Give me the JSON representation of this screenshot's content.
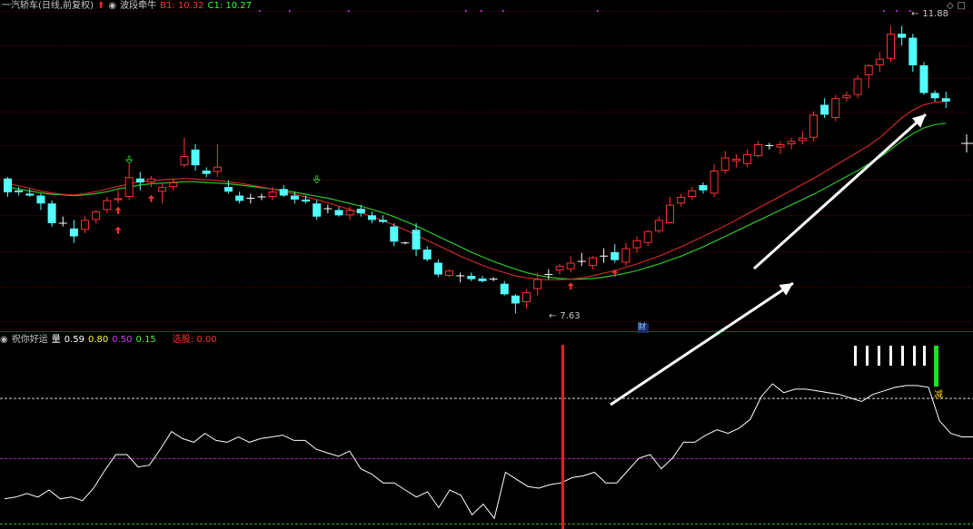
{
  "header": {
    "security": "一汽轿车(日线,前复权)",
    "indicator": "波段牵牛",
    "b1_label": "B1: 10.32",
    "c1_label": "C1: 10.27"
  },
  "sub_header": {
    "indicator": "祝你好运",
    "vol_label": "量",
    "v1": "0.59",
    "v2": "0.80",
    "v3": "0.50",
    "v4": "0.15",
    "select_label": "选股: 0.00"
  },
  "annotations": {
    "high_label": "11.88",
    "low_label": "7.63",
    "finance_badge": "财",
    "sell_badge": "减"
  },
  "colors": {
    "up": "#ff3232",
    "down": "#54ffff",
    "ma_red": "#c82828",
    "ma_green": "#28c828",
    "grid": "#6a0000",
    "signal_line": "#e61e1e",
    "oscillator": "#ffffff"
  },
  "chart_data": [
    {
      "type": "candlestick",
      "title": "一汽轿车(日线,前复权)",
      "series_name": "波段牵牛",
      "ohlc": [
        [
          9.68,
          9.7,
          9.4,
          9.47
        ],
        [
          9.5,
          9.55,
          9.42,
          9.47
        ],
        [
          9.45,
          9.52,
          9.4,
          9.42
        ],
        [
          9.42,
          9.45,
          9.2,
          9.3
        ],
        [
          9.3,
          9.35,
          8.95,
          9.0
        ],
        [
          9.0,
          9.1,
          8.95,
          8.98
        ],
        [
          8.92,
          9.05,
          8.7,
          8.8
        ],
        [
          8.9,
          9.1,
          8.85,
          9.05
        ],
        [
          9.05,
          9.2,
          9.0,
          9.18
        ],
        [
          9.2,
          9.4,
          9.15,
          9.35
        ],
        [
          9.35,
          9.5,
          9.3,
          9.38
        ],
        [
          9.4,
          9.9,
          9.35,
          9.7
        ],
        [
          9.68,
          9.78,
          9.5,
          9.62
        ],
        [
          9.62,
          9.72,
          9.55,
          9.68
        ],
        [
          9.48,
          9.6,
          9.3,
          9.55
        ],
        [
          9.55,
          9.68,
          9.5,
          9.62
        ],
        [
          9.88,
          10.3,
          9.85,
          10.02
        ],
        [
          10.12,
          10.2,
          9.8,
          9.88
        ],
        [
          9.8,
          9.85,
          9.7,
          9.75
        ],
        [
          9.78,
          10.2,
          9.7,
          9.86
        ],
        [
          9.55,
          9.65,
          9.45,
          9.48
        ],
        [
          9.42,
          9.48,
          9.3,
          9.34
        ],
        [
          9.38,
          9.45,
          9.3,
          9.36
        ],
        [
          9.38,
          9.45,
          9.35,
          9.4
        ],
        [
          9.4,
          9.55,
          9.35,
          9.48
        ],
        [
          9.52,
          9.58,
          9.4,
          9.42
        ],
        [
          9.42,
          9.48,
          9.3,
          9.36
        ],
        [
          9.36,
          9.42,
          9.3,
          9.33
        ],
        [
          9.3,
          9.35,
          9.05,
          9.1
        ],
        [
          9.2,
          9.28,
          9.15,
          9.22
        ],
        [
          9.2,
          9.25,
          9.1,
          9.12
        ],
        [
          9.12,
          9.25,
          9.05,
          9.2
        ],
        [
          9.22,
          9.28,
          9.1,
          9.15
        ],
        [
          9.12,
          9.18,
          9.0,
          9.05
        ],
        [
          9.05,
          9.12,
          9.0,
          9.02
        ],
        [
          8.95,
          9.0,
          8.65,
          8.72
        ],
        [
          8.7,
          8.72,
          8.68,
          8.7
        ],
        [
          8.9,
          9.0,
          8.5,
          8.6
        ],
        [
          8.6,
          8.65,
          8.42,
          8.45
        ],
        [
          8.4,
          8.45,
          8.18,
          8.22
        ],
        [
          8.2,
          8.3,
          8.18,
          8.28
        ],
        [
          8.18,
          8.25,
          8.1,
          8.2
        ],
        [
          8.2,
          8.25,
          8.12,
          8.15
        ],
        [
          8.16,
          8.2,
          8.1,
          8.12
        ],
        [
          8.15,
          8.18,
          8.12,
          8.15
        ],
        [
          8.08,
          8.12,
          7.9,
          7.92
        ],
        [
          7.9,
          7.92,
          7.63,
          7.78
        ],
        [
          7.8,
          8.0,
          7.7,
          7.95
        ],
        [
          8.0,
          8.25,
          7.9,
          8.15
        ],
        [
          8.2,
          8.3,
          8.15,
          8.22
        ],
        [
          8.28,
          8.38,
          8.22,
          8.35
        ],
        [
          8.3,
          8.5,
          8.25,
          8.4
        ],
        [
          8.4,
          8.55,
          8.35,
          8.42
        ],
        [
          8.35,
          8.5,
          8.3,
          8.48
        ],
        [
          8.48,
          8.62,
          8.4,
          8.5
        ],
        [
          8.56,
          8.68,
          8.4,
          8.44
        ],
        [
          8.4,
          8.7,
          8.35,
          8.62
        ],
        [
          8.62,
          8.8,
          8.55,
          8.74
        ],
        [
          8.7,
          8.9,
          8.65,
          8.88
        ],
        [
          8.88,
          9.1,
          8.85,
          9.05
        ],
        [
          9.0,
          9.4,
          9.0,
          9.28
        ],
        [
          9.3,
          9.45,
          9.25,
          9.4
        ],
        [
          9.4,
          9.55,
          9.35,
          9.5
        ],
        [
          9.58,
          9.62,
          9.45,
          9.5
        ],
        [
          9.45,
          9.9,
          9.4,
          9.8
        ],
        [
          9.8,
          10.1,
          9.75,
          10.0
        ],
        [
          9.94,
          10.05,
          9.85,
          9.98
        ],
        [
          9.9,
          10.12,
          9.85,
          10.05
        ],
        [
          10.02,
          10.25,
          10.0,
          10.2
        ],
        [
          10.18,
          10.22,
          10.12,
          10.18
        ],
        [
          10.15,
          10.25,
          10.05,
          10.2
        ],
        [
          10.2,
          10.3,
          10.12,
          10.25
        ],
        [
          10.25,
          10.4,
          10.2,
          10.3
        ],
        [
          10.3,
          10.7,
          10.25,
          10.65
        ],
        [
          10.8,
          10.9,
          10.6,
          10.65
        ],
        [
          10.6,
          10.95,
          10.55,
          10.9
        ],
        [
          10.9,
          11.0,
          10.85,
          10.95
        ],
        [
          10.95,
          11.25,
          10.9,
          11.2
        ],
        [
          11.25,
          11.42,
          11.05,
          11.4
        ],
        [
          11.4,
          11.6,
          11.3,
          11.5
        ],
        [
          11.5,
          12.0,
          11.45,
          11.88
        ],
        [
          11.88,
          12.0,
          11.7,
          11.82
        ],
        [
          11.82,
          11.88,
          11.3,
          11.4
        ],
        [
          11.4,
          11.45,
          10.95,
          10.98
        ],
        [
          10.98,
          11.02,
          10.85,
          10.9
        ],
        [
          10.9,
          11.0,
          10.75,
          10.85
        ]
      ],
      "ma_slow": [
        9.55,
        9.52,
        9.49,
        9.46,
        9.44,
        9.43,
        9.42,
        9.43,
        9.45,
        9.48,
        9.52,
        9.55,
        9.58,
        9.6,
        9.61,
        9.62,
        9.63,
        9.63,
        9.62,
        9.61,
        9.6,
        9.58,
        9.56,
        9.54,
        9.52,
        9.5,
        9.47,
        9.44,
        9.41,
        9.38,
        9.34,
        9.3,
        9.26,
        9.21,
        9.16,
        9.1,
        9.03,
        8.96,
        8.88,
        8.8,
        8.72,
        8.64,
        8.56,
        8.49,
        8.42,
        8.36,
        8.3,
        8.25,
        8.21,
        8.18,
        8.16,
        8.15,
        8.15,
        8.16,
        8.18,
        8.21,
        8.24,
        8.28,
        8.33,
        8.38,
        8.44,
        8.5,
        8.57,
        8.64,
        8.72,
        8.8,
        8.88,
        8.96,
        9.04,
        9.12,
        9.2,
        9.28,
        9.36,
        9.44,
        9.53,
        9.62,
        9.71,
        9.8,
        9.9,
        10.0,
        10.12,
        10.25,
        10.36,
        10.45,
        10.5,
        10.52
      ],
      "ma_fast": [
        9.6,
        9.57,
        9.53,
        9.49,
        9.46,
        9.44,
        9.43,
        9.45,
        9.48,
        9.52,
        9.56,
        9.6,
        9.63,
        9.65,
        9.66,
        9.67,
        9.68,
        9.67,
        9.66,
        9.65,
        9.63,
        9.61,
        9.58,
        9.55,
        9.52,
        9.48,
        9.44,
        9.4,
        9.36,
        9.31,
        9.26,
        9.21,
        9.16,
        9.1,
        9.04,
        8.97,
        8.9,
        8.82,
        8.74,
        8.66,
        8.58,
        8.5,
        8.43,
        8.36,
        8.3,
        8.25,
        8.2,
        8.17,
        8.15,
        8.14,
        8.14,
        8.15,
        8.17,
        8.2,
        8.24,
        8.28,
        8.33,
        8.38,
        8.44,
        8.5,
        8.57,
        8.64,
        8.72,
        8.8,
        8.88,
        8.96,
        9.05,
        9.14,
        9.23,
        9.32,
        9.41,
        9.5,
        9.59,
        9.68,
        9.78,
        9.88,
        9.98,
        10.08,
        10.18,
        10.3,
        10.45,
        10.6,
        10.72,
        10.8,
        10.84,
        10.85
      ],
      "high_marker": 11.88,
      "low_marker": 7.63
    },
    {
      "type": "line",
      "title": "祝你好运",
      "series": [
        {
          "name": "量",
          "values": [
            0.15,
            0.16,
            0.18,
            0.16,
            0.2,
            0.15,
            0.16,
            0.14,
            0.21,
            0.31,
            0.4,
            0.4,
            0.33,
            0.34,
            0.43,
            0.53,
            0.49,
            0.47,
            0.52,
            0.48,
            0.47,
            0.5,
            0.47,
            0.49,
            0.5,
            0.51,
            0.48,
            0.48,
            0.43,
            0.41,
            0.39,
            0.42,
            0.32,
            0.29,
            0.24,
            0.24,
            0.2,
            0.16,
            0.19,
            0.1,
            0.2,
            0.17,
            0.06,
            0.12,
            0.04,
            0.3,
            0.26,
            0.22,
            0.21,
            0.23,
            0.24,
            0.27,
            0.28,
            0.3,
            0.24,
            0.24,
            0.31,
            0.38,
            0.4,
            0.32,
            0.38,
            0.47,
            0.47,
            0.51,
            0.54,
            0.52,
            0.55,
            0.6,
            0.73,
            0.8,
            0.75,
            0.77,
            0.77,
            0.76,
            0.75,
            0.74,
            0.72,
            0.7,
            0.74,
            0.76,
            0.78,
            0.79,
            0.79,
            0.78,
            0.59,
            0.52,
            0.5,
            0.5
          ]
        }
      ],
      "levels": [
        0.72,
        0.38,
        0.01
      ]
    }
  ]
}
